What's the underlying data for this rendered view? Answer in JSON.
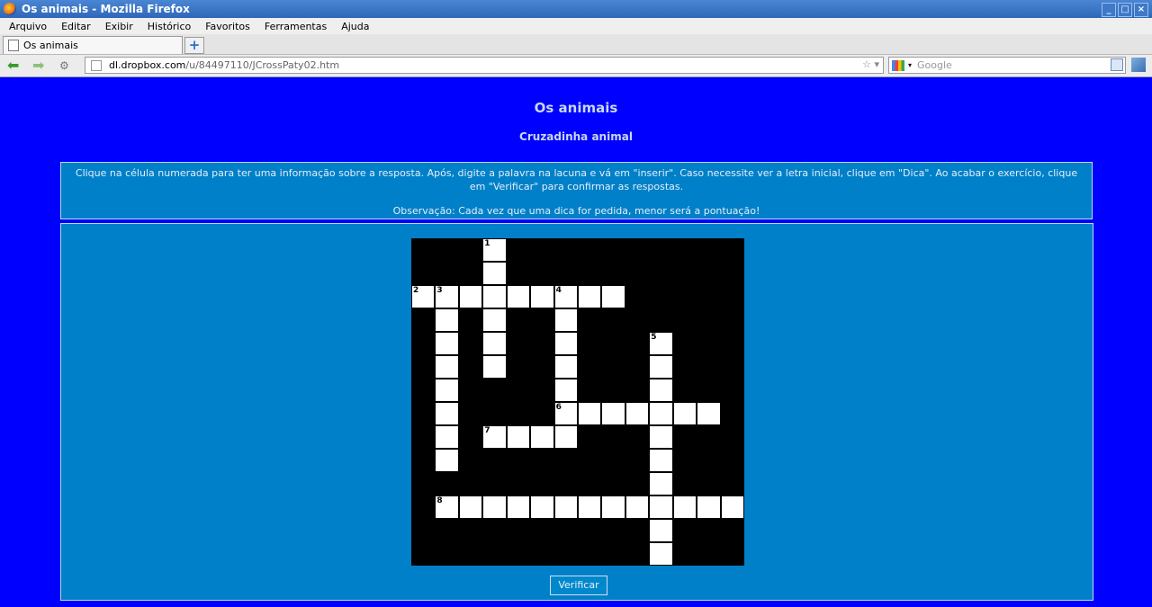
{
  "window": {
    "title": "Os animais - Mozilla Firefox",
    "controls": [
      "_",
      "□",
      "×"
    ]
  },
  "menu": [
    "Arquivo",
    "Editar",
    "Exibir",
    "Histórico",
    "Favoritos",
    "Ferramentas",
    "Ajuda"
  ],
  "tab": {
    "label": "Os animais",
    "new_tab": "+"
  },
  "nav": {
    "back_icon": "back-arrow-icon",
    "forward_icon": "forward-arrow-icon",
    "url_host": "dl.dropbox.com",
    "url_rest": "/u/84497110/JCrossPaty02.htm",
    "url_tools": "☆ ▾",
    "search_placeholder": "Google"
  },
  "page": {
    "title": "Os animais",
    "subtitle": "Cruzadinha animal",
    "instructions": "Clique na célula numerada para ter uma informação sobre a resposta. Após, digite a palavra na lacuna e vá em \"inserir\". Caso necessite ver a letra inicial, clique em \"Dica\". Ao acabar o exercício, clique em \"Verificar\" para confirmar as respostas.",
    "note": "Observação: Cada vez que uma dica for pedida, menor será a pontuação!",
    "verify_label": "Verificar"
  },
  "crossword": {
    "rows": 14,
    "cols": 14,
    "cells": [
      [
        0,
        3,
        "1"
      ],
      [
        1,
        3,
        ""
      ],
      [
        2,
        0,
        "2"
      ],
      [
        2,
        1,
        "3"
      ],
      [
        2,
        2,
        ""
      ],
      [
        2,
        3,
        ""
      ],
      [
        2,
        4,
        ""
      ],
      [
        2,
        5,
        ""
      ],
      [
        2,
        6,
        "4"
      ],
      [
        2,
        7,
        ""
      ],
      [
        2,
        8,
        ""
      ],
      [
        3,
        1,
        ""
      ],
      [
        3,
        3,
        ""
      ],
      [
        3,
        6,
        ""
      ],
      [
        4,
        1,
        ""
      ],
      [
        4,
        3,
        ""
      ],
      [
        4,
        6,
        ""
      ],
      [
        4,
        10,
        "5"
      ],
      [
        5,
        1,
        ""
      ],
      [
        5,
        3,
        ""
      ],
      [
        5,
        6,
        ""
      ],
      [
        5,
        10,
        ""
      ],
      [
        6,
        1,
        ""
      ],
      [
        6,
        6,
        ""
      ],
      [
        6,
        10,
        ""
      ],
      [
        7,
        1,
        ""
      ],
      [
        7,
        6,
        "6"
      ],
      [
        7,
        7,
        ""
      ],
      [
        7,
        8,
        ""
      ],
      [
        7,
        9,
        ""
      ],
      [
        7,
        10,
        ""
      ],
      [
        7,
        11,
        ""
      ],
      [
        7,
        12,
        ""
      ],
      [
        8,
        1,
        ""
      ],
      [
        8,
        3,
        "7"
      ],
      [
        8,
        4,
        ""
      ],
      [
        8,
        5,
        ""
      ],
      [
        8,
        6,
        ""
      ],
      [
        8,
        10,
        ""
      ],
      [
        9,
        1,
        ""
      ],
      [
        9,
        10,
        ""
      ],
      [
        10,
        10,
        ""
      ],
      [
        11,
        1,
        "8"
      ],
      [
        11,
        2,
        ""
      ],
      [
        11,
        3,
        ""
      ],
      [
        11,
        4,
        ""
      ],
      [
        11,
        5,
        ""
      ],
      [
        11,
        6,
        ""
      ],
      [
        11,
        7,
        ""
      ],
      [
        11,
        8,
        ""
      ],
      [
        11,
        9,
        ""
      ],
      [
        11,
        10,
        ""
      ],
      [
        11,
        11,
        ""
      ],
      [
        11,
        12,
        ""
      ],
      [
        11,
        13,
        ""
      ],
      [
        12,
        10,
        ""
      ],
      [
        13,
        10,
        ""
      ]
    ]
  }
}
